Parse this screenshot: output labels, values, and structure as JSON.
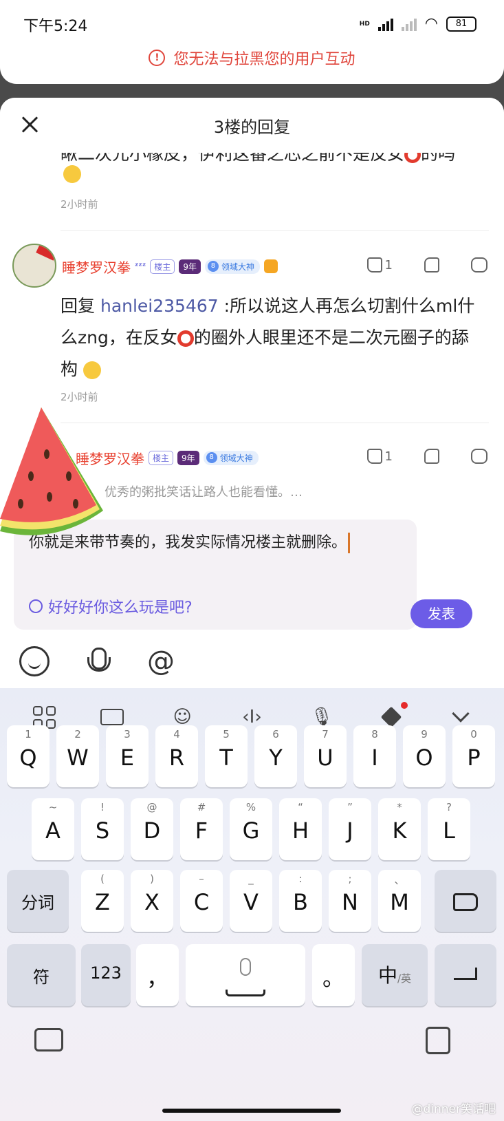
{
  "status_bar": {
    "time": "下午5:24",
    "battery": "81",
    "network_label": "HD"
  },
  "warning": {
    "icon": "!",
    "text": "您无法与拉黑您的用户互动"
  },
  "sheet": {
    "title": "3楼的回复",
    "close_icon": "close-icon"
  },
  "prev_comment": {
    "partial_text": "瞅二次元小橡皮，伊利这番之芯之前不是反女",
    "partial_tail": "的吗",
    "time": "2小时前"
  },
  "comment": {
    "username": "睡梦罗汉拳",
    "zzz": "ᶻᶻᶻ",
    "tag_owner": "楼主",
    "tag_years": "9年",
    "level_num": "8",
    "level_name": "领域大神",
    "like_count": "1",
    "reply_prefix": "回复",
    "reply_user": "hanlei235467",
    "text_1": " :所以说这人再怎么切割什么ml什么zng，在反女",
    "text_2": "的圈外人眼里还不是二次元圈子的舔构",
    "time": "2小时前"
  },
  "next_comment": {
    "username": "睡梦罗汉拳",
    "tag_owner": "楼主",
    "tag_years": "9年",
    "level_num": "8",
    "level_name": "领域大神",
    "like_count": "1"
  },
  "input": {
    "quote": "优秀的粥批笑话让路人也能看懂。…",
    "text": "你就是来带节奏的，我发实际情况楼主就删除。",
    "suggestion": "好好好你这么玩是吧?",
    "publish": "发表"
  },
  "keyboard": {
    "row1": [
      {
        "k": "Q",
        "h": "1"
      },
      {
        "k": "W",
        "h": "2"
      },
      {
        "k": "E",
        "h": "3"
      },
      {
        "k": "R",
        "h": "4"
      },
      {
        "k": "T",
        "h": "5"
      },
      {
        "k": "Y",
        "h": "6"
      },
      {
        "k": "U",
        "h": "7"
      },
      {
        "k": "I",
        "h": "8"
      },
      {
        "k": "O",
        "h": "9"
      },
      {
        "k": "P",
        "h": "0"
      }
    ],
    "row2": [
      {
        "k": "A",
        "h": "~"
      },
      {
        "k": "S",
        "h": "!"
      },
      {
        "k": "D",
        "h": "@"
      },
      {
        "k": "F",
        "h": "#"
      },
      {
        "k": "G",
        "h": "%"
      },
      {
        "k": "H",
        "h": "“"
      },
      {
        "k": "J",
        "h": "”"
      },
      {
        "k": "K",
        "h": "*"
      },
      {
        "k": "L",
        "h": "?"
      }
    ],
    "row3": [
      {
        "k": "Z",
        "h": "("
      },
      {
        "k": "X",
        "h": ")"
      },
      {
        "k": "C",
        "h": "–"
      },
      {
        "k": "V",
        "h": "_"
      },
      {
        "k": "B",
        "h": ":"
      },
      {
        "k": "N",
        "h": ";"
      },
      {
        "k": "M",
        "h": "、"
      }
    ],
    "segment_key": "分词",
    "symbol_key": "符",
    "num_key": "123",
    "comma_key": "，",
    "period_key": "。",
    "lang_key": "中",
    "lang_sub": "/英"
  },
  "watermark": "@dinner笑话吧"
}
